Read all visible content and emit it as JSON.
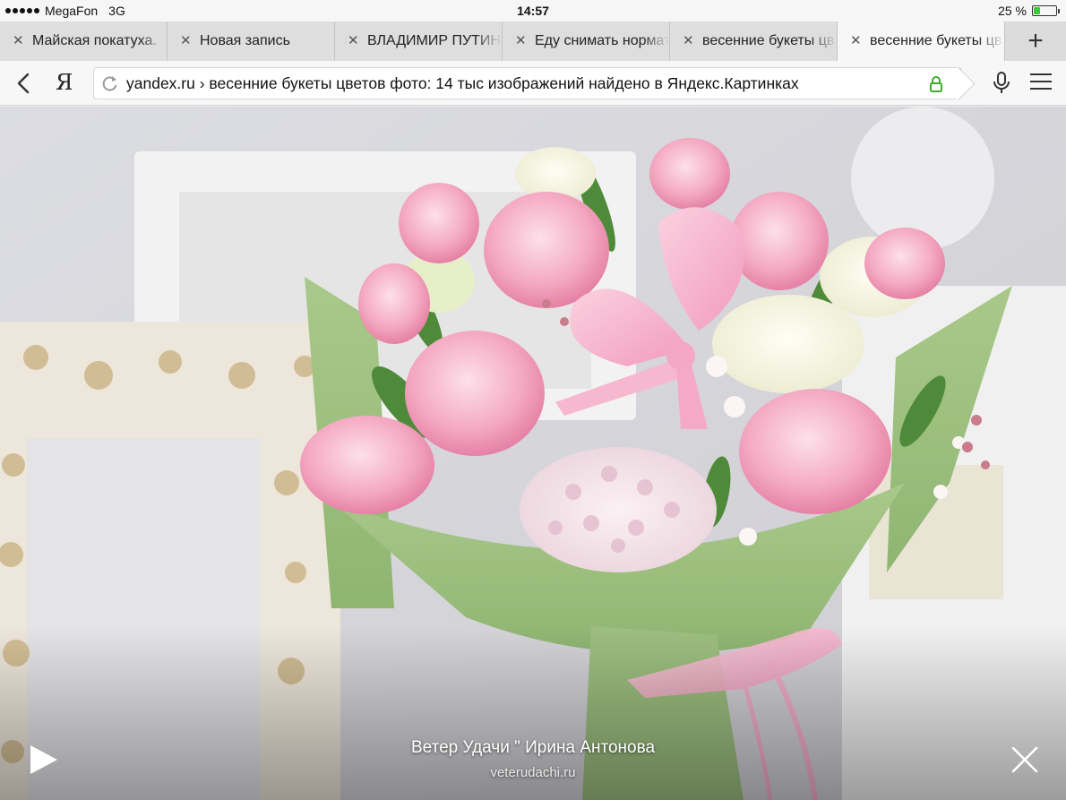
{
  "status_bar": {
    "carrier": "MegaFon",
    "network": "3G",
    "time": "14:57",
    "battery_text": "25 %",
    "battery_level": 0.25,
    "battery_color": "#3cc93c"
  },
  "tabs": [
    {
      "label": "Майская покатуха."
    },
    {
      "label": "Новая запись"
    },
    {
      "label": "ВЛАДИМИР ПУТИН"
    },
    {
      "label": "Еду снимать нормат"
    },
    {
      "label": "весенние букеты цв"
    },
    {
      "label": "весенние букеты цв",
      "active": true
    }
  ],
  "new_tab_label": "+",
  "nav": {
    "yandex_label": "Я",
    "url": "yandex.ru › весенние букеты цветов фото: 14 тыс изображений найдено в Яндекс.Картинках",
    "lock_color": "#3dae2b"
  },
  "viewer": {
    "caption_title": "Ветер Удачи \" Ирина Антонова",
    "caption_source": "veterudachi.ru"
  }
}
